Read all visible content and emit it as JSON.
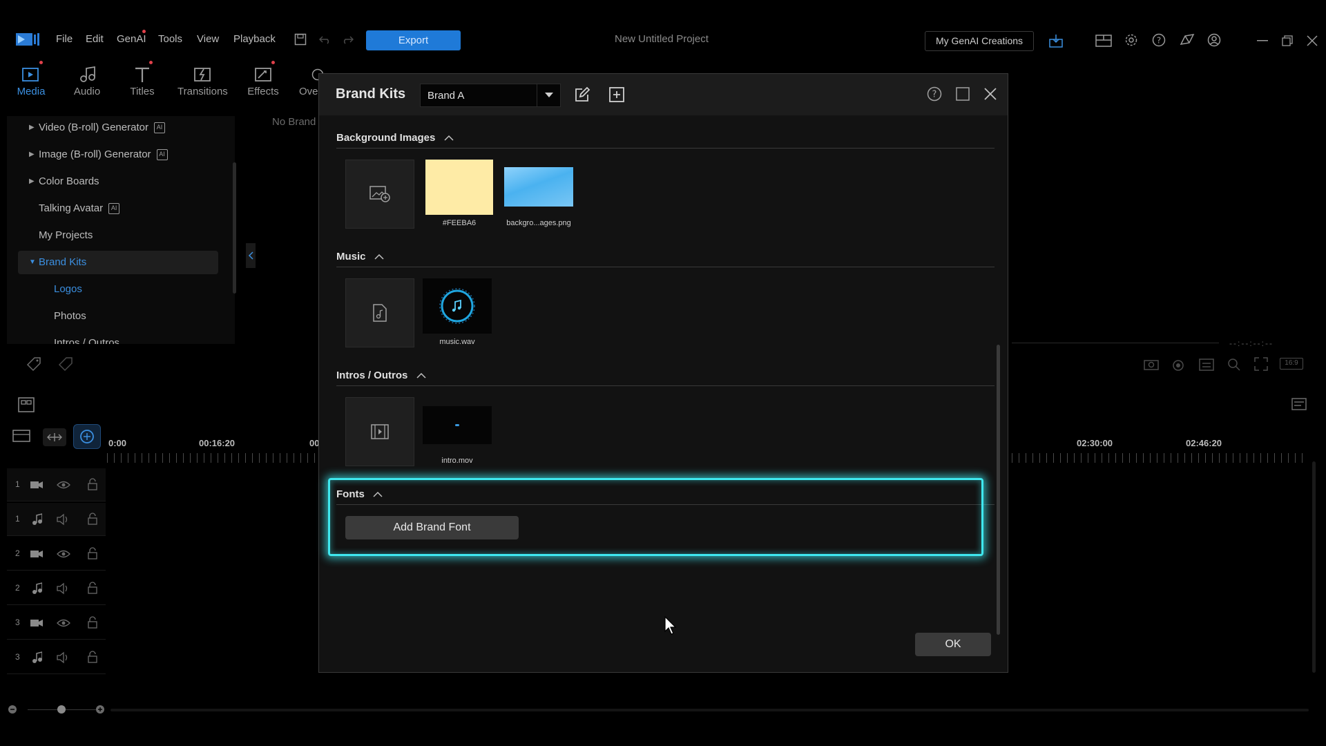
{
  "menu": {
    "items": [
      "File",
      "Edit",
      "GenAI",
      "Tools",
      "View",
      "Playback"
    ],
    "export_label": "Export",
    "project_title": "New Untitled Project",
    "genai_creations_label": "My GenAI Creations"
  },
  "modules": [
    {
      "label": "Media",
      "icon": "media-icon"
    },
    {
      "label": "Audio",
      "icon": "music-note-icon"
    },
    {
      "label": "Titles",
      "icon": "title-t-icon"
    },
    {
      "label": "Transitions",
      "icon": "transitions-icon"
    },
    {
      "label": "Effects",
      "icon": "effects-icon"
    },
    {
      "label": "Ove",
      "icon": "overlay-icon"
    }
  ],
  "library": {
    "items": [
      {
        "label": "Video (B-roll) Generator",
        "expandable": true,
        "ai": true
      },
      {
        "label": "Image (B-roll) Generator",
        "expandable": true,
        "ai": true
      },
      {
        "label": "Color Boards",
        "expandable": true,
        "ai": false
      },
      {
        "label": "Talking Avatar",
        "expandable": false,
        "ai": true
      },
      {
        "label": "My Projects",
        "expandable": false,
        "ai": false
      },
      {
        "label": "Brand Kits",
        "expandable": true,
        "ai": false,
        "selected": true
      },
      {
        "label": "Logos",
        "child": true
      },
      {
        "label": "Photos",
        "child": true
      },
      {
        "label": "Intros / Outros",
        "child": true
      }
    ],
    "content_hint": "No Brand"
  },
  "timeline": {
    "ruler": [
      "0:00",
      "00:16:20",
      "00",
      "02:30:00",
      "02:46:20"
    ],
    "tracks": [
      "1",
      "1",
      "2",
      "2",
      "3",
      "3"
    ],
    "aspect_ratio": "16:9"
  },
  "dialog": {
    "title": "Brand Kits",
    "selected_brand": "Brand A",
    "sections": {
      "background_images": {
        "title": "Background Images",
        "items": [
          {
            "label": "#FEEBA6",
            "color": "#FEEBA6"
          },
          {
            "label": "backgro...ages.png"
          }
        ]
      },
      "music": {
        "title": "Music",
        "items": [
          {
            "label": "music.wav"
          }
        ]
      },
      "intros_outros": {
        "title": "Intros / Outros",
        "items": [
          {
            "label": "intro.mov"
          }
        ]
      },
      "fonts": {
        "title": "Fonts",
        "add_label": "Add Brand Font"
      }
    },
    "ok_label": "OK"
  },
  "colors": {
    "accent": "#3b8fe0",
    "highlight": "#3fe8ef",
    "export": "#1f7ad8"
  }
}
